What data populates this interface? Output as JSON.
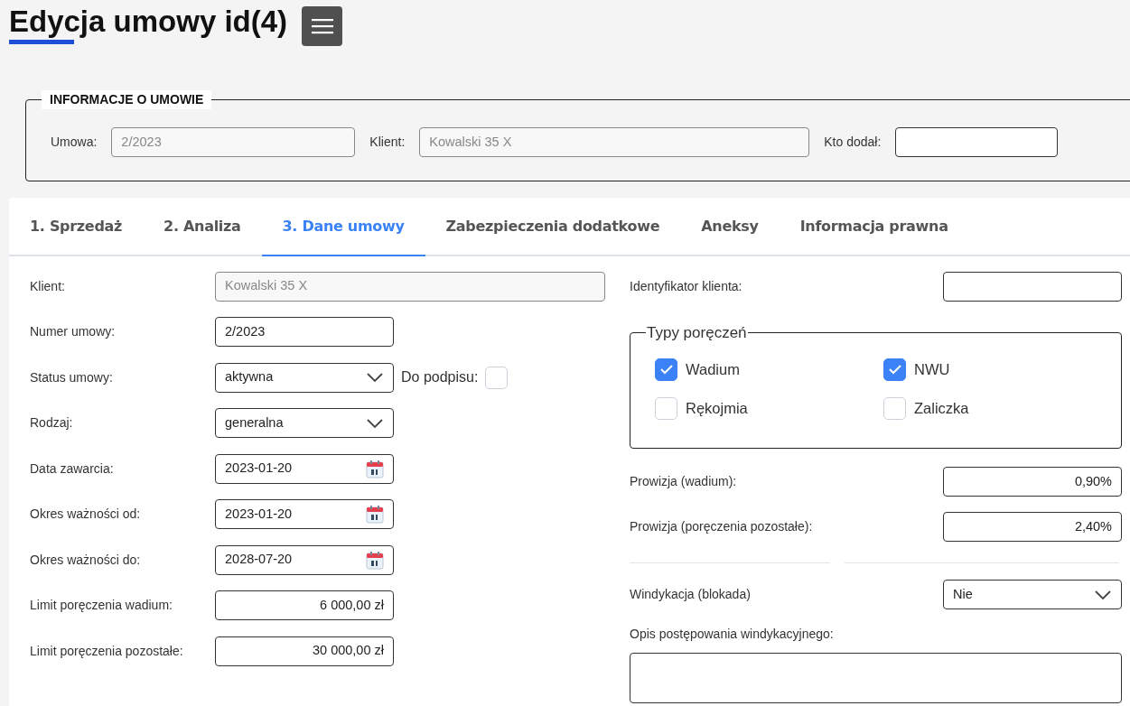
{
  "page": {
    "title": "Edycja umowy id(4)"
  },
  "contract_info": {
    "legend": "INFORMACJE O UMOWIE",
    "fields": [
      {
        "label": "Umowa:",
        "value": "2/2023",
        "disabled": true
      },
      {
        "label": "Klient:",
        "value": "Kowalski 35 X",
        "disabled": true
      },
      {
        "label": "Kto dodał:",
        "disabled": false
      }
    ]
  },
  "tabs": [
    {
      "label": "1. Sprzedaż",
      "selected": false
    },
    {
      "label": "2. Analiza",
      "selected": false
    },
    {
      "label": "3. Dane umowy",
      "selected": true
    },
    {
      "label": "Zabezpieczenia dodatkowe",
      "selected": false
    },
    {
      "label": "Aneksy",
      "selected": false
    },
    {
      "label": "Informacja prawna",
      "selected": false
    }
  ],
  "left_fields": [
    {
      "kind": "text",
      "label": "Klient:",
      "value": "Kowalski 35 X",
      "disabled": true,
      "wide": true
    },
    {
      "kind": "text",
      "label": "Numer umowy:",
      "value": "2/2023",
      "disabled": false,
      "wide": false
    },
    {
      "kind": "select",
      "label": "Status umowy:",
      "value": "aktywna",
      "extra": {
        "label": "Do podpisu:",
        "checked": false
      }
    },
    {
      "kind": "select",
      "label": "Rodzaj:",
      "value": "generalna"
    },
    {
      "kind": "date",
      "label": "Data zawarcia:",
      "value": "2023-01-20"
    },
    {
      "kind": "date",
      "label": "Okres ważności od:",
      "value": "2023-01-20"
    },
    {
      "kind": "date",
      "label": "Okres ważności do:",
      "value": "2028-07-20"
    },
    {
      "kind": "money",
      "label": "Limit poręczenia wadium:",
      "value": "6 000,00 zł"
    },
    {
      "kind": "money",
      "label": "Limit poręczenia pozostałe:",
      "value": "30 000,00 zł"
    }
  ],
  "client_id": {
    "label": "Identyfikator klienta:"
  },
  "guarantee_types": {
    "legend": "Typy poręczeń",
    "options": [
      {
        "label": "Wadium",
        "checked": true
      },
      {
        "label": "NWU",
        "checked": true
      },
      {
        "label": "Rękojmia",
        "checked": false
      },
      {
        "label": "Zaliczka",
        "checked": false
      }
    ]
  },
  "commissions": [
    {
      "label": "Prowizja (wadium):",
      "value": "0,90%"
    },
    {
      "label": "Prowizja (poręczenia pozostałe):",
      "value": "2,40%"
    }
  ],
  "debt_collection": {
    "label": "Windykacja (blokada)",
    "value": "Nie"
  },
  "debt_description": {
    "label": "Opis postępowania windykacyjnego:"
  }
}
